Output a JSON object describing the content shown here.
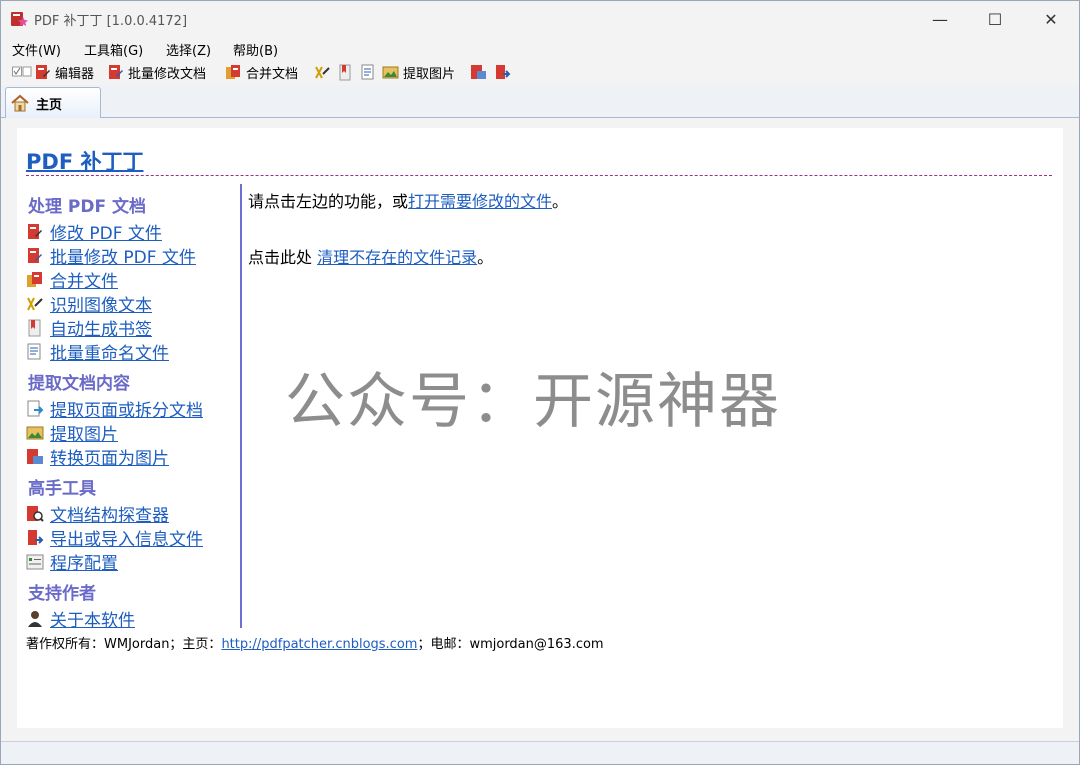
{
  "window": {
    "title": "PDF 补丁丁 [1.0.0.4172]",
    "min_glyph": "—",
    "max_glyph": "☐",
    "close_glyph": "✕"
  },
  "menubar": {
    "file": "文件(W)",
    "tools": "工具箱(G)",
    "options": "选择(Z)",
    "help": "帮助(B)"
  },
  "toolbar": {
    "editor": "编辑器",
    "batch_modify": "批量修改文档",
    "merge": "合并文档",
    "extract_images": "提取图片"
  },
  "tabs": {
    "home": "主页"
  },
  "page": {
    "title": "PDF 补丁丁",
    "sections": {
      "process": "处理 PDF 文档",
      "extract": "提取文档内容",
      "advanced": "高手工具",
      "support": "支持作者"
    },
    "links": {
      "modify_pdf": "修改 PDF 文件",
      "batch_modify_pdf": "批量修改 PDF 文件",
      "merge_files": "合并文件",
      "ocr": "识别图像文本",
      "auto_bookmark": "自动生成书签",
      "batch_rename": "批量重命名文件",
      "extract_pages": "提取页面或拆分文档",
      "extract_images": "提取图片",
      "pages_to_images": "转换页面为图片",
      "structure_explorer": "文档结构探查器",
      "export_import_info": "导出或导入信息文件",
      "settings": "程序配置",
      "about": "关于本软件"
    },
    "main": {
      "line1_prefix": "请点击左边的功能，或",
      "line1_link": "打开需要修改的文件",
      "line1_suffix": "。",
      "line2_prefix": "点击此处 ",
      "line2_link": "清理不存在的文件记录",
      "line2_suffix": "。"
    },
    "watermark": "公众号：开源神器",
    "footer": {
      "prefix": "著作权所有：WMJordan；主页：",
      "link": "http://pdfpatcher.cnblogs.com",
      "suffix": "；电邮：wmjordan@163.com"
    }
  },
  "colors": {
    "link": "#1d5ec0",
    "section_head": "#6a6ac8",
    "rule": "#a0308c",
    "sidebar_border": "#6f6fd6"
  }
}
